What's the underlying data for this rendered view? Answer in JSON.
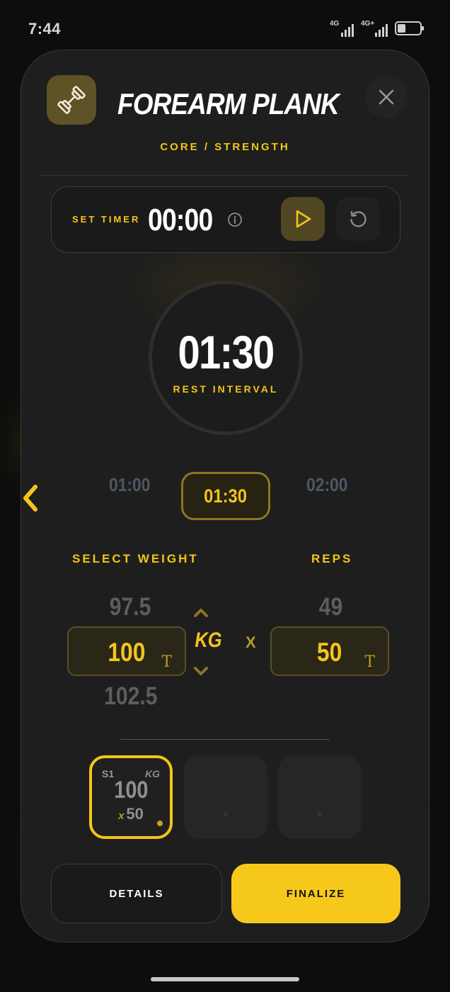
{
  "status_bar": {
    "time": "7:44",
    "network_1": "4G",
    "network_2": "4G+"
  },
  "exercise": {
    "title": "FOREARM PLANK",
    "category": "CORE / STRENGTH",
    "icon": "dumbbell-icon"
  },
  "set_timer": {
    "label": "SET TIMER",
    "value": "00:00"
  },
  "rest": {
    "value": "01:30",
    "label": "REST INTERVAL"
  },
  "intervals": {
    "options": [
      "01:00",
      "01:30",
      "02:00"
    ],
    "selected": "01:30"
  },
  "weight": {
    "label": "SELECT WEIGHT",
    "prev": "97.5",
    "current": "100",
    "next": "102.5",
    "unit": "KG"
  },
  "reps": {
    "label": "REPS",
    "prev": "49",
    "current": "50",
    "times_symbol": "X"
  },
  "sets": [
    {
      "label": "S1",
      "unit": "KG",
      "weight": "100",
      "x": "x",
      "reps": "50",
      "active": true
    },
    {
      "label": "",
      "unit": "",
      "weight": "",
      "x": "x",
      "reps": "",
      "active": false
    },
    {
      "label": "",
      "unit": "",
      "weight": "",
      "x": "x",
      "reps": "",
      "active": false
    }
  ],
  "buttons": {
    "details": "DETAILS",
    "finalize": "FINALIZE"
  },
  "colors": {
    "accent": "#f5c518",
    "background": "#0d0d0d",
    "card": "#1e1e1e",
    "finalize_bg": "#f7c81c"
  }
}
